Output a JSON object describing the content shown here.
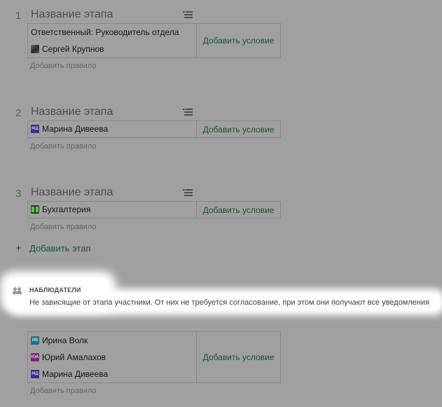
{
  "stages": [
    {
      "number": "1",
      "title": "Название этапа",
      "responsible": "Ответственный: Руководитель отдела",
      "members": [
        {
          "initials": "",
          "name": "Сергей Крупнов",
          "avatar": "photo"
        }
      ],
      "add_condition": "Добавить условие",
      "add_rule": "Добавить правило"
    },
    {
      "number": "2",
      "title": "Название этапа",
      "members": [
        {
          "initials": "МД",
          "name": "Марина Дивеева",
          "avatar": "md"
        }
      ],
      "add_condition": "Добавить условие",
      "add_rule": "Добавить правило"
    },
    {
      "number": "3",
      "title": "Название этапа",
      "members": [
        {
          "initials": "",
          "name": "Бухгалтерия",
          "avatar": "department-icon"
        }
      ],
      "add_condition": "Добавить условие",
      "add_rule": "Добавить правило"
    }
  ],
  "add_stage": {
    "icon": "plus-icon",
    "label": "Добавить этап"
  },
  "observers": {
    "icon": "users-icon",
    "title": "НАБЛЮДАТЕЛИ",
    "description": "Не зависящие от этапа участники. От них не требуется согласование, при этом они получают все уведомления",
    "members": [
      {
        "initials": "ИВ",
        "name": "Ирина Волк",
        "avatar": "iv"
      },
      {
        "initials": "ЮА",
        "name": "Юрий Амалахов",
        "avatar": "ua"
      },
      {
        "initials": "МД",
        "name": "Марина Дивеева",
        "avatar": "md"
      }
    ],
    "add_condition": "Добавить условие",
    "add_rule": "Добавить правило"
  },
  "colors": {
    "accent_link": "#1e5232",
    "overlay": "#a0a0a0",
    "highlight": "#ffffff"
  }
}
